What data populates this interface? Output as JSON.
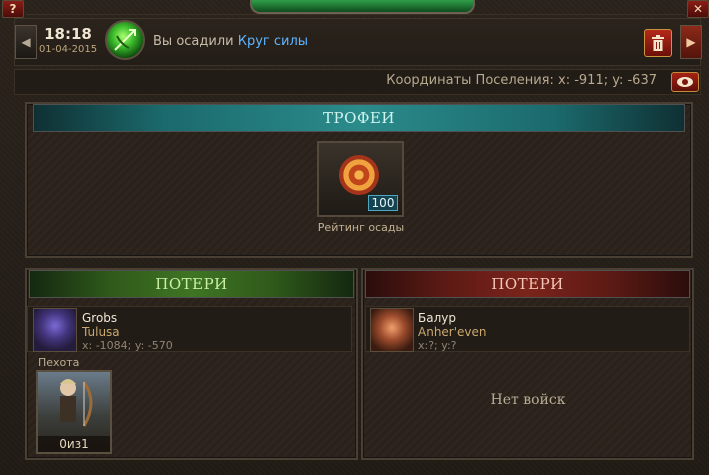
{
  "header": {
    "help_label": "?",
    "close_label": "✕",
    "time": "18:18",
    "date": "01-04-2015",
    "event_prefix": "Вы осадили",
    "event_link": "Круг силы",
    "event_icon": "bow-arrow-icon",
    "prev_icon": "chevron-left-icon",
    "next_icon": "chevron-right-icon",
    "delete_icon": "trash-icon"
  },
  "coords": {
    "text": "Координаты Поселения: x: -911; y: -637",
    "view_icon": "eye-icon"
  },
  "trophies": {
    "title": "ТРОФЕИ",
    "item": {
      "icon": "target-icon",
      "count": "100",
      "label": "Рейтинг осады"
    }
  },
  "losses_left": {
    "title": "ПОТЕРИ",
    "player": {
      "name": "Grobs",
      "city": "Tulusa",
      "coords": "x: -1084; y: -570"
    },
    "unit_type": "Пехота",
    "unit": {
      "icon": "archer-unit-icon",
      "count": "0из1"
    }
  },
  "losses_right": {
    "title": "ПОТЕРИ",
    "player": {
      "name": "Балур",
      "city": "Anher'even",
      "coords": "x:?; y:?"
    },
    "empty_text": "Нет войск"
  },
  "colors": {
    "accent_teal": "#2b8b8b",
    "accent_green": "#3f7424",
    "accent_red": "#7a241b",
    "link": "#5fb4ff"
  }
}
